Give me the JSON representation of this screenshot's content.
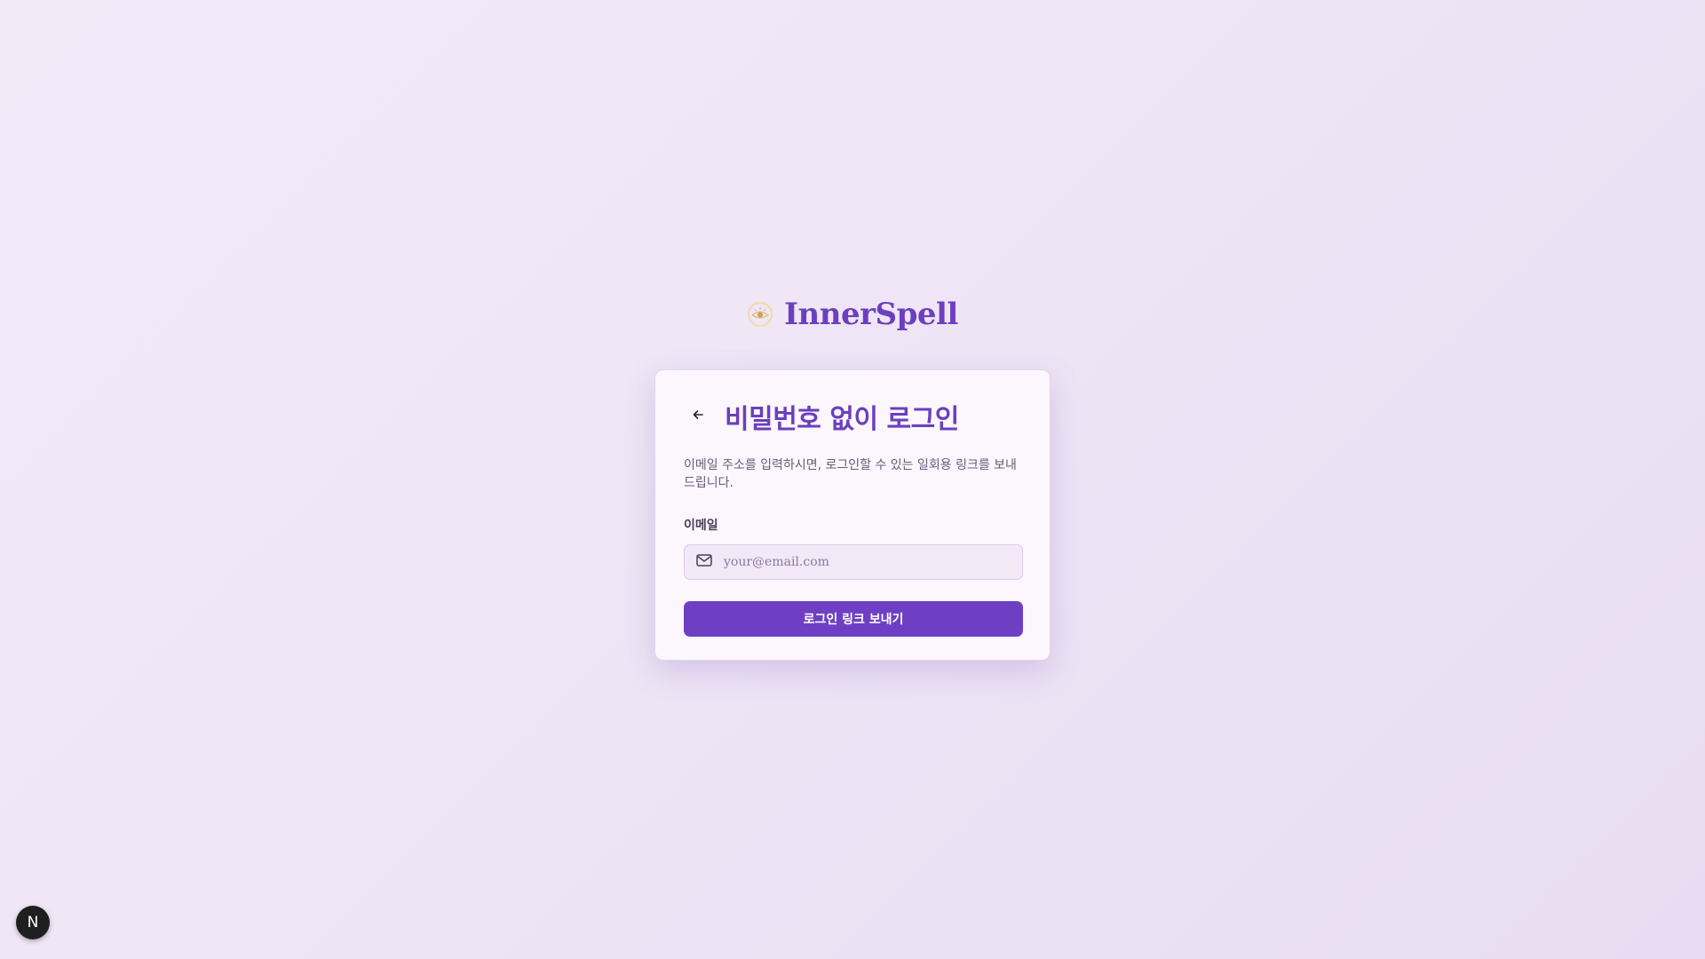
{
  "brand": {
    "name": "InnerSpell",
    "logo_icon": "eye-moon-icon",
    "color": "#6b3fbf"
  },
  "card": {
    "back_icon": "arrow-left-icon",
    "title": "비밀번호 없이 로그인",
    "description": "이메일 주소를 입력하시면, 로그인할 수 있는 일회용 링크를 보내드립니다.",
    "email_label": "이메일",
    "email_icon": "mail-icon",
    "email_placeholder": "your@email.com",
    "email_value": "",
    "submit_label": "로그인 링크 보내기"
  },
  "dev_badge": {
    "label": "N",
    "icon": "nextjs-icon"
  },
  "colors": {
    "accent": "#6e3fc3",
    "background": "#f0e6f7"
  }
}
